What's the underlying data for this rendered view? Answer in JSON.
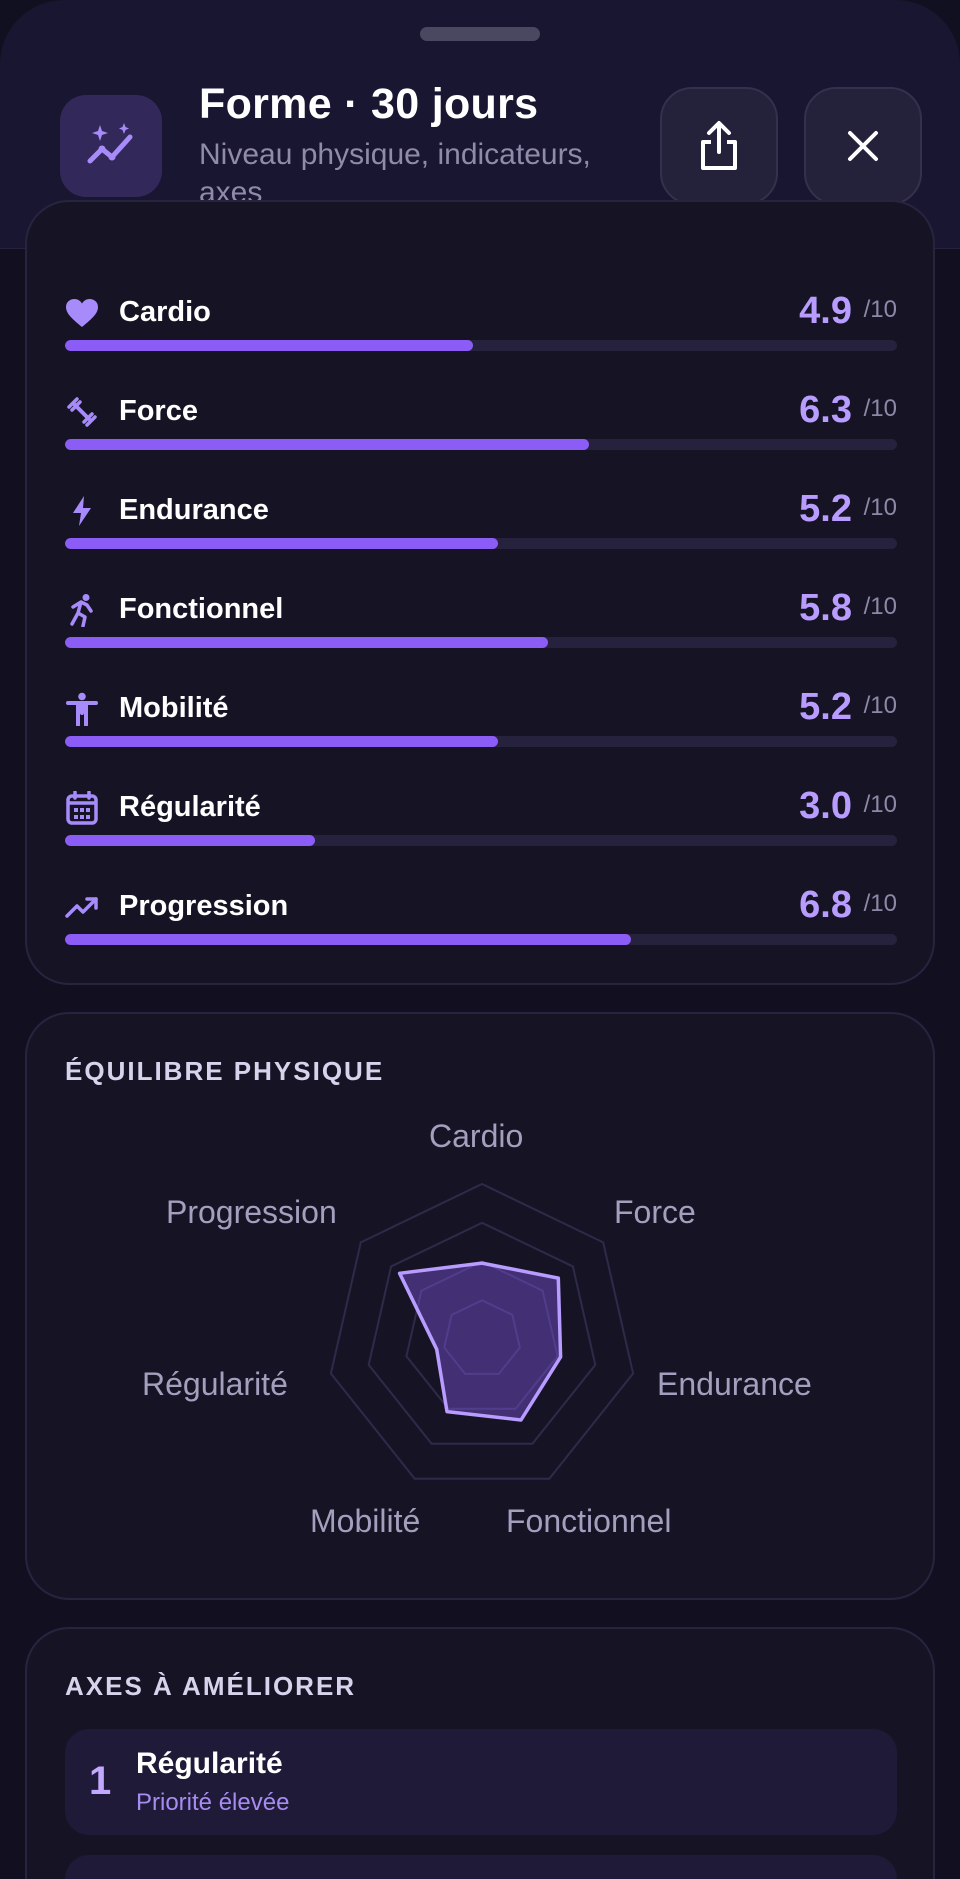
{
  "header": {
    "title": "Forme · 30 jours",
    "subtitle": "Niveau physique, indicateurs, axes",
    "app_icon": "chart-sparkle-icon",
    "share_icon": "share-icon",
    "close_icon": "close-icon"
  },
  "metrics": [
    {
      "label": "Cardio",
      "value": "4.9",
      "max": "/10",
      "icon": "heart-icon",
      "level": 0.49
    },
    {
      "label": "Force",
      "value": "6.3",
      "max": "/10",
      "icon": "dumbbell-icon",
      "level": 0.63
    },
    {
      "label": "Endurance",
      "value": "5.2",
      "max": "/10",
      "icon": "bolt-icon",
      "level": 0.52
    },
    {
      "label": "Fonctionnel",
      "value": "5.8",
      "max": "/10",
      "icon": "running-icon",
      "level": 0.58
    },
    {
      "label": "Mobilité",
      "value": "5.2",
      "max": "/10",
      "icon": "person-stretch-icon",
      "level": 0.52
    },
    {
      "label": "Régularité",
      "value": "3.0",
      "max": "/10",
      "icon": "calendar-icon",
      "level": 0.3
    },
    {
      "label": "Progression",
      "value": "6.8",
      "max": "/10",
      "icon": "trending-up-icon",
      "level": 0.68
    }
  ],
  "balance": {
    "title": "ÉQUILIBRE PHYSIQUE"
  },
  "chart_data": {
    "type": "radar",
    "categories": [
      "Cardio",
      "Force",
      "Endurance",
      "Fonctionnel",
      "Mobilité",
      "Régularité",
      "Progression"
    ],
    "values": [
      4.9,
      6.3,
      5.2,
      5.8,
      5.2,
      3.0,
      6.8
    ],
    "rlim": [
      0,
      10
    ],
    "grid_rings": 4
  },
  "improve": {
    "title": "AXES À AMÉLIORER",
    "items": [
      {
        "rank": "1",
        "name": "Régularité",
        "priority": "Priorité élevée"
      }
    ]
  },
  "colors": {
    "accent": "#8c5cf6",
    "accent_light": "#b89cff",
    "background": "#121020",
    "card": "#161424"
  }
}
